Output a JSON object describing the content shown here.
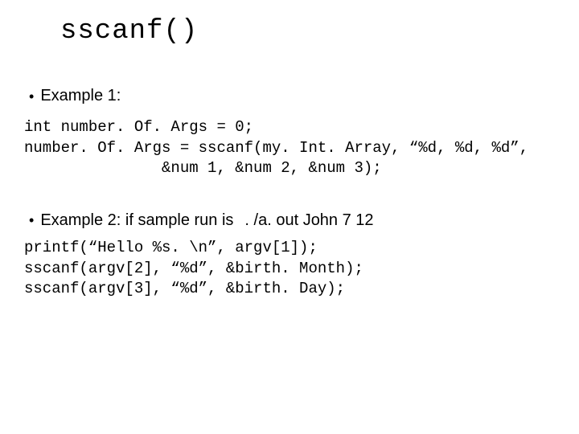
{
  "title": "sscanf()",
  "example1": {
    "label": "Example 1:",
    "code": "int number. Of. Args = 0;\nnumber. Of. Args = sscanf(my. Int. Array, “%d, %d, %d”,\n               &num 1, &num 2, &num 3);"
  },
  "example2": {
    "label": "Example 2:  if sample run is",
    "cmd": ". /a. out John 7 12",
    "code": "printf(“Hello %s. \\n”, argv[1]);\nsscanf(argv[2], “%d”, &birth. Month);\nsscanf(argv[3], “%d”, &birth. Day);"
  }
}
